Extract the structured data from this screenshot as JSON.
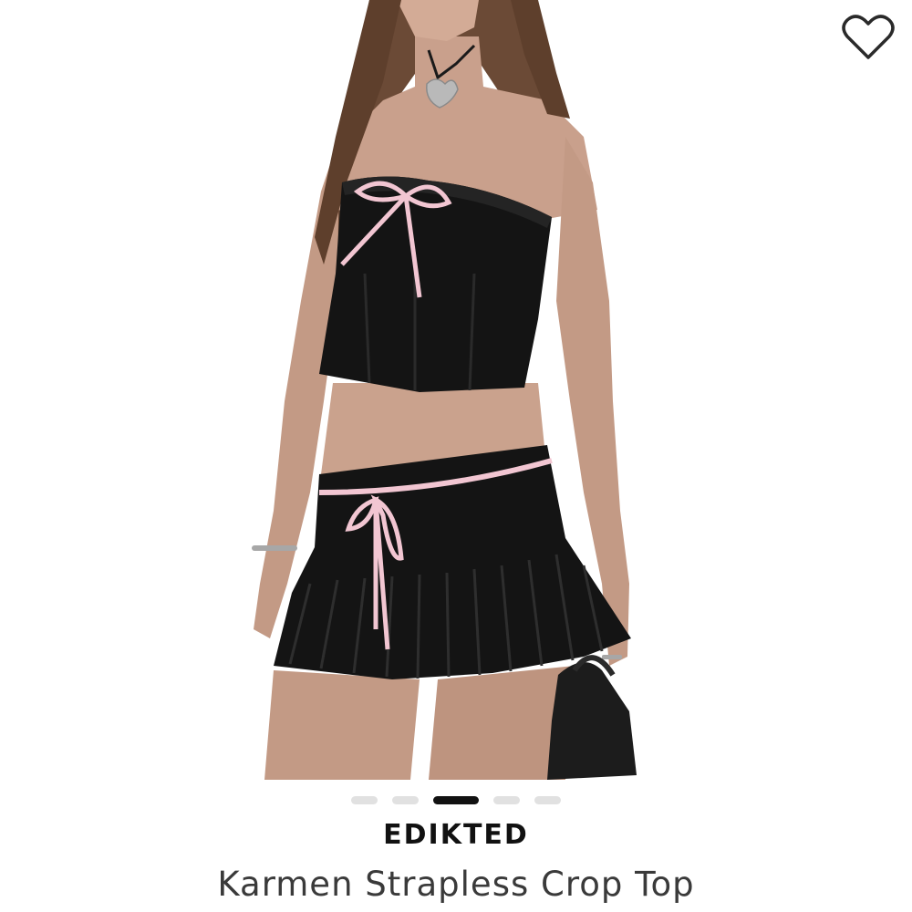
{
  "product": {
    "brand": "EDIKTED",
    "title": "Karmen Strapless Crop Top"
  },
  "gallery": {
    "image_count": 5,
    "active_index": 2
  },
  "icons": {
    "favorite": "heart-outline-icon"
  },
  "colors": {
    "background": "#ffffff",
    "text_primary": "#111111",
    "text_secondary": "#3a3a3a",
    "dot_inactive": "#e1e1e1",
    "dot_active": "#111111",
    "ribbon_pink": "#f2c6d2",
    "garment_black": "#141414"
  }
}
